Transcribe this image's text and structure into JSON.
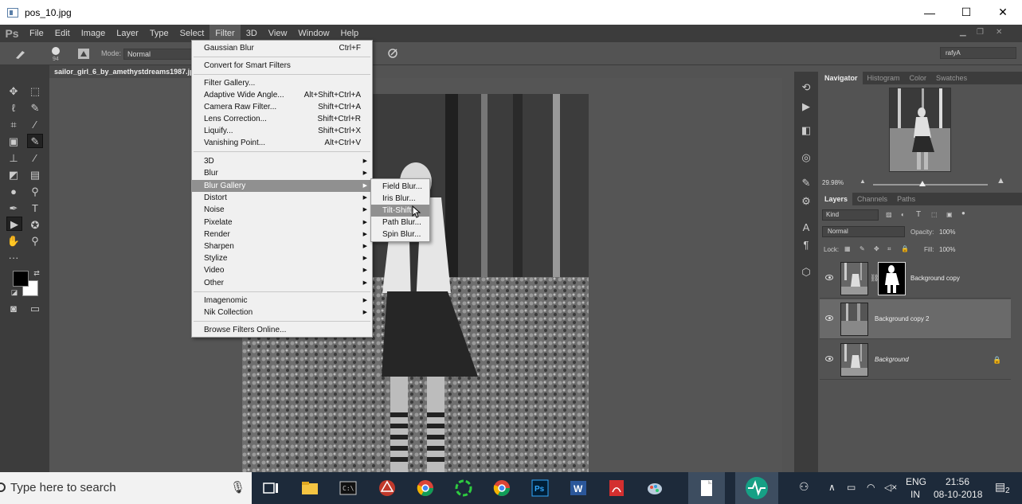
{
  "window": {
    "title": "pos_10.jpg",
    "minimize_glyph": "—",
    "maximize_glyph": "☐",
    "close_glyph": "✕"
  },
  "menubar": {
    "logo": "Ps",
    "items": [
      "File",
      "Edit",
      "Image",
      "Layer",
      "Type",
      "Select",
      "Filter",
      "3D",
      "View",
      "Window",
      "Help"
    ],
    "active": "Filter"
  },
  "options": {
    "mode_label": "Mode:",
    "mode_value": "Normal",
    "brush_size": "94",
    "user": "rafyA"
  },
  "document": {
    "tab_title": "sailor_girl_6_by_amethystdreams1987.jpg"
  },
  "filter_menu": {
    "items": [
      {
        "label": "Gaussian Blur",
        "shortcut": "Ctrl+F"
      },
      {
        "label": "Convert for Smart Filters",
        "shortcut": ""
      },
      {
        "label": "Filter Gallery...",
        "shortcut": ""
      },
      {
        "label": "Adaptive Wide Angle...",
        "shortcut": "Alt+Shift+Ctrl+A"
      },
      {
        "label": "Camera Raw Filter...",
        "shortcut": "Shift+Ctrl+A"
      },
      {
        "label": "Lens Correction...",
        "shortcut": "Shift+Ctrl+R"
      },
      {
        "label": "Liquify...",
        "shortcut": "Shift+Ctrl+X"
      },
      {
        "label": "Vanishing Point...",
        "shortcut": "Alt+Ctrl+V"
      },
      {
        "label": "3D",
        "shortcut": ""
      },
      {
        "label": "Blur",
        "shortcut": ""
      },
      {
        "label": "Blur Gallery",
        "shortcut": ""
      },
      {
        "label": "Distort",
        "shortcut": ""
      },
      {
        "label": "Noise",
        "shortcut": ""
      },
      {
        "label": "Pixelate",
        "shortcut": ""
      },
      {
        "label": "Render",
        "shortcut": ""
      },
      {
        "label": "Sharpen",
        "shortcut": ""
      },
      {
        "label": "Stylize",
        "shortcut": ""
      },
      {
        "label": "Video",
        "shortcut": ""
      },
      {
        "label": "Other",
        "shortcut": ""
      },
      {
        "label": "Imagenomic",
        "shortcut": ""
      },
      {
        "label": "Nik Collection",
        "shortcut": ""
      },
      {
        "label": "Browse Filters Online...",
        "shortcut": ""
      }
    ],
    "highlighted": "Blur Gallery"
  },
  "blur_gallery_submenu": {
    "items": [
      "Field Blur...",
      "Iris Blur...",
      "Tilt-Shift...",
      "Path Blur...",
      "Spin Blur..."
    ],
    "highlighted": "Tilt-Shift..."
  },
  "navigator_panel": {
    "tabs": [
      "Navigator",
      "Histogram",
      "Color",
      "Swatches"
    ],
    "active_tab": "Navigator",
    "zoom": "29.98%"
  },
  "layers_panel": {
    "tabs": [
      "Layers",
      "Channels",
      "Paths"
    ],
    "active_tab": "Layers",
    "filter_kind": "Kind",
    "blend_mode": "Normal",
    "opacity_label": "Opacity:",
    "opacity": "100%",
    "lock_label": "Lock:",
    "fill_label": "Fill:",
    "fill": "100%",
    "layers": [
      {
        "name": "Background copy",
        "has_mask": true,
        "selected": false,
        "locked": false
      },
      {
        "name": "Background copy 2",
        "has_mask": false,
        "selected": true,
        "locked": false
      },
      {
        "name": "Background",
        "has_mask": false,
        "selected": false,
        "locked": true
      }
    ]
  },
  "taskbar": {
    "search_placeholder": "Type here to search",
    "language": "ENG",
    "region": "IN",
    "time": "21:56",
    "date": "08-10-2018",
    "notification_count": "2"
  }
}
